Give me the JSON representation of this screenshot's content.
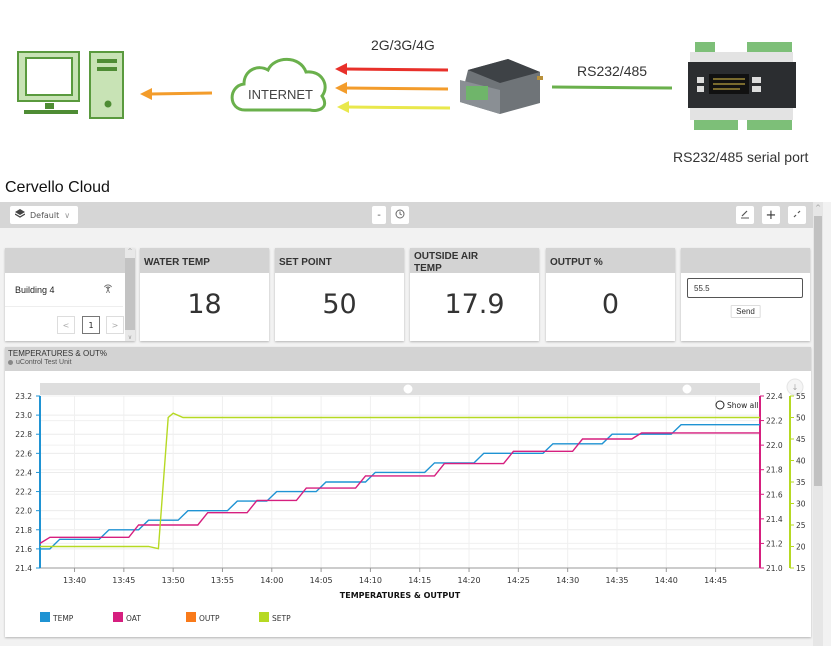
{
  "diagram": {
    "network_label": "2G/3G/4G",
    "internet_label": "INTERNET",
    "serial_link_label": "RS232/485",
    "controller_caption": "RS232/485 serial port",
    "computer_icon": "desktop-computer-icon",
    "cloud_icon": "cloud-icon",
    "modem_icon": "gsm-modem-image",
    "controller_icon": "plc-controller-image",
    "arrow_colors": [
      "#e8302a",
      "#f39c2b",
      "#e9e84c"
    ],
    "link_color": "#6ab04c"
  },
  "section_title": "Cervello Cloud",
  "toolbar": {
    "layer_select": "Default",
    "layer_icon": "layers-icon",
    "minus_label": "-",
    "clock_icon": "clock-icon",
    "edit_icon": "pencil-icon",
    "add_label": "+",
    "collapse_icon": "collapse-icon"
  },
  "device_widget": {
    "device_name": "Building 4",
    "signal_icon": "signal-antenna-icon",
    "page": "1",
    "prev_label": "<",
    "next_label": ">"
  },
  "widgets": [
    {
      "title": "WATER TEMP",
      "value": "18"
    },
    {
      "title": "SET POINT",
      "value": "50"
    },
    {
      "title": "OUTSIDE AIR TEMP",
      "value": "17.9"
    },
    {
      "title": "OUTPUT %",
      "value": "0"
    }
  ],
  "input_widget": {
    "value": "55.5",
    "send_label": "Send"
  },
  "chart_panel": {
    "title": "TEMPERATURES & OUT%",
    "subtitle": "uControl Test Unit",
    "show_all_label": "Show all"
  },
  "chart_data": {
    "type": "line",
    "xlabel": "TEMPERATURES & OUTPUT",
    "x_ticks": [
      "13:40",
      "13:45",
      "13:50",
      "13:55",
      "14:00",
      "14:05",
      "14:10",
      "14:15",
      "14:20",
      "14:25",
      "14:30",
      "14:35",
      "14:40",
      "14:45"
    ],
    "x_range_minutes": [
      0,
      73
    ],
    "axes": {
      "left": {
        "series": "TEMP",
        "color": "#1f93d3",
        "ylim": [
          21.4,
          23.2
        ],
        "ticks": [
          "21.4",
          "21.6",
          "21.8",
          "22.0",
          "22.2",
          "22.4",
          "22.6",
          "22.8",
          "23.0",
          "23.2"
        ]
      },
      "right1": {
        "series": "OAT",
        "color": "#d61f7f",
        "ylim": [
          21.0,
          22.4
        ],
        "ticks": [
          "21.0",
          "21.2",
          "21.4",
          "21.6",
          "21.8",
          "22.0",
          "22.2",
          "22.4"
        ]
      },
      "right2": {
        "series": "SETP",
        "color": "#b6d923",
        "ylim": [
          15,
          55
        ],
        "ticks": [
          "15",
          "20",
          "25",
          "30",
          "35",
          "40",
          "45",
          "50",
          "55"
        ]
      }
    },
    "grid": true,
    "legend_position": "bottom-left",
    "series": [
      {
        "name": "TEMP",
        "color": "#1f93d3",
        "axis": "left",
        "points": [
          [
            0,
            21.6
          ],
          [
            1,
            21.6
          ],
          [
            2,
            21.7
          ],
          [
            6,
            21.7
          ],
          [
            7,
            21.8
          ],
          [
            10,
            21.8
          ],
          [
            11,
            21.9
          ],
          [
            14,
            21.9
          ],
          [
            15,
            22.0
          ],
          [
            19,
            22.0
          ],
          [
            20,
            22.1
          ],
          [
            23,
            22.1
          ],
          [
            24,
            22.2
          ],
          [
            28,
            22.2
          ],
          [
            29,
            22.3
          ],
          [
            33,
            22.3
          ],
          [
            34,
            22.4
          ],
          [
            39,
            22.4
          ],
          [
            40,
            22.5
          ],
          [
            44,
            22.5
          ],
          [
            45,
            22.6
          ],
          [
            51,
            22.6
          ],
          [
            52,
            22.7
          ],
          [
            57,
            22.7
          ],
          [
            58,
            22.8
          ],
          [
            64,
            22.8
          ],
          [
            65,
            22.9
          ],
          [
            73,
            22.9
          ]
        ]
      },
      {
        "name": "OAT",
        "color": "#d61f7f",
        "axis": "right1",
        "points": [
          [
            0,
            21.2
          ],
          [
            1,
            21.25
          ],
          [
            9,
            21.25
          ],
          [
            10,
            21.35
          ],
          [
            16,
            21.35
          ],
          [
            17,
            21.45
          ],
          [
            21,
            21.45
          ],
          [
            22,
            21.55
          ],
          [
            26,
            21.55
          ],
          [
            27,
            21.65
          ],
          [
            32,
            21.65
          ],
          [
            33,
            21.75
          ],
          [
            40,
            21.75
          ],
          [
            41,
            21.85
          ],
          [
            47,
            21.85
          ],
          [
            48,
            21.95
          ],
          [
            54,
            21.95
          ],
          [
            55,
            22.05
          ],
          [
            60,
            22.05
          ],
          [
            61,
            22.1
          ],
          [
            73,
            22.1
          ]
        ]
      },
      {
        "name": "OUTP",
        "color": "#f97a1a",
        "axis": "right2",
        "points": []
      },
      {
        "name": "SETP",
        "color": "#b6d923",
        "axis": "right2",
        "points": [
          [
            0,
            20
          ],
          [
            11,
            20
          ],
          [
            12,
            19.5
          ],
          [
            13,
            50
          ],
          [
            13.5,
            51
          ],
          [
            14.5,
            50
          ],
          [
            73,
            50
          ]
        ]
      }
    ]
  }
}
